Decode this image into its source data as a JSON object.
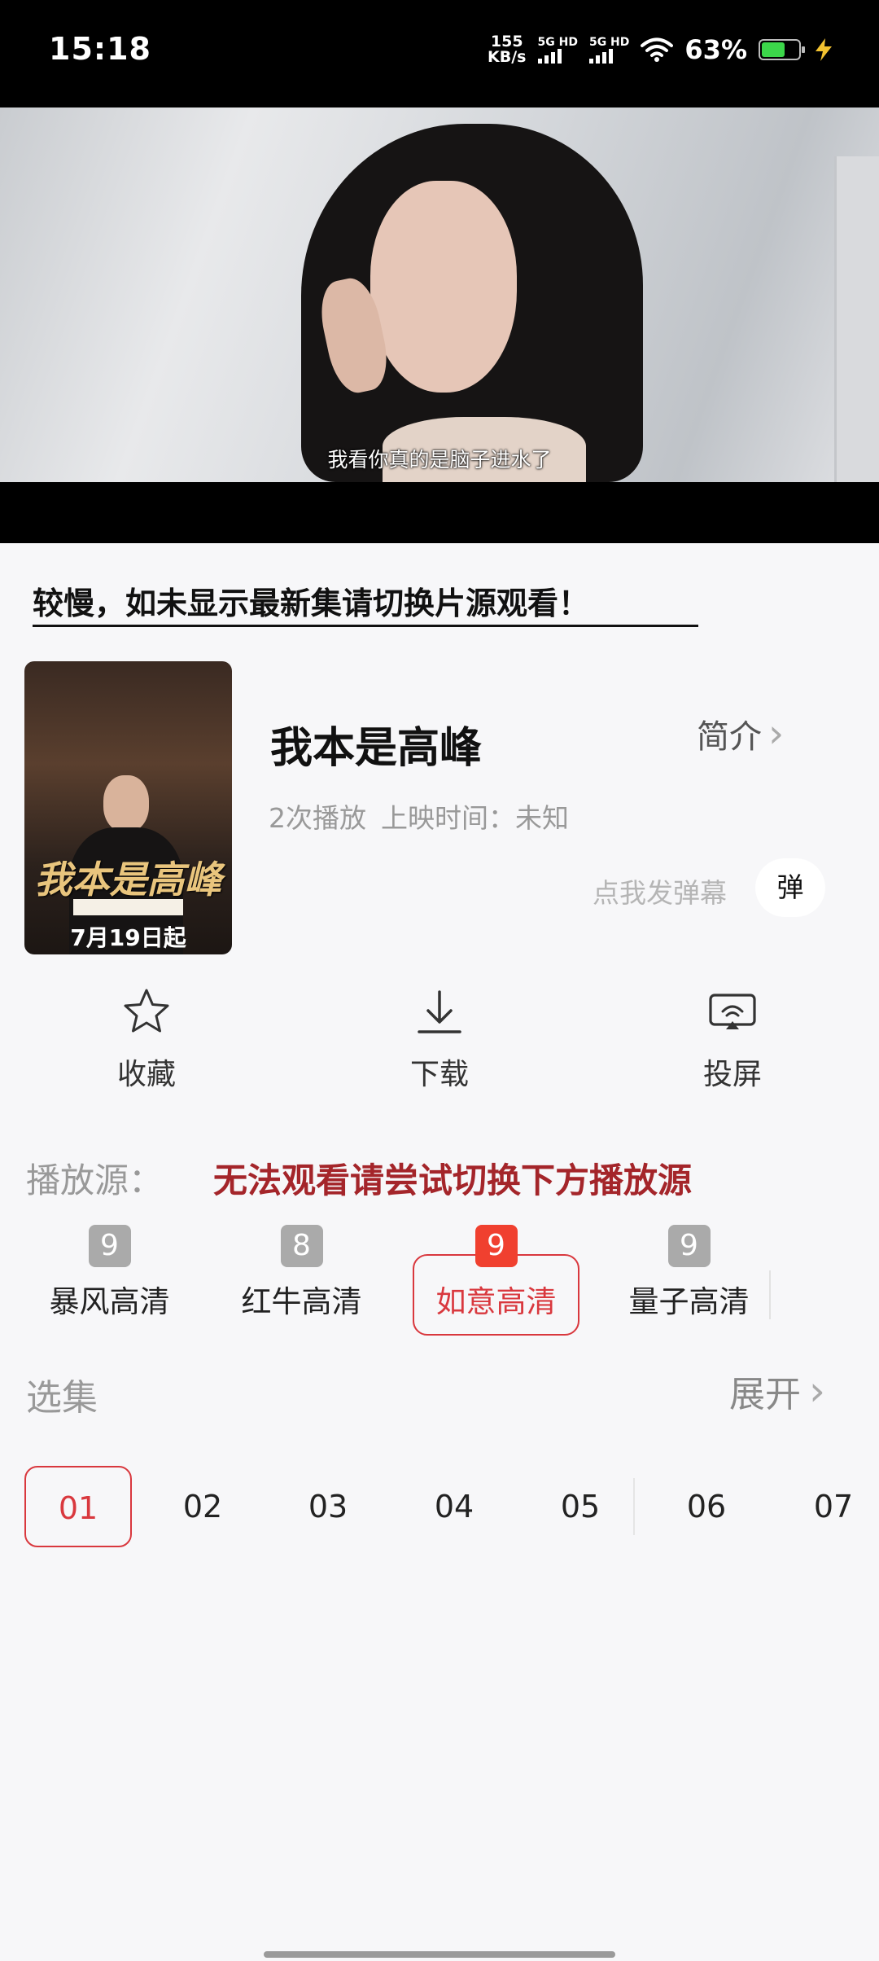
{
  "status_bar": {
    "time": "15:18",
    "net_speed_value": "155",
    "net_speed_unit": "KB/s",
    "signal1": "5G HD",
    "signal2": "5G HD",
    "battery": "63%",
    "battery_level": 0.63,
    "icons": [
      "wifi-icon",
      "battery-icon",
      "charging-icon"
    ]
  },
  "video": {
    "subtitle": "我看你真的是脑子进水了"
  },
  "notice": "较慢，如未显示最新集请切换片源观看！",
  "show": {
    "poster_title": "我本是高峰",
    "poster_date": "7月19日起",
    "title": "我本是高峰",
    "intro_label": "简介",
    "plays": "2次播放",
    "release": "上映时间：未知",
    "danmu_hint": "点我发弹幕",
    "danmu_button": "弹"
  },
  "actions": [
    {
      "label": "收藏",
      "icon": "star-icon"
    },
    {
      "label": "下载",
      "icon": "download-icon"
    },
    {
      "label": "投屏",
      "icon": "cast-icon"
    }
  ],
  "sources": {
    "label": "播放源：",
    "warning": "无法观看请尝试切换下方播放源",
    "items": [
      {
        "label": "暴风高清",
        "count": "9"
      },
      {
        "label": "红牛高清",
        "count": "8"
      },
      {
        "label": "如意高清",
        "count": "9",
        "active": true
      },
      {
        "label": "量子高清",
        "count": "9"
      }
    ]
  },
  "episodes": {
    "label": "选集",
    "expand_label": "展开",
    "items": [
      "01",
      "02",
      "03",
      "04",
      "05",
      "06",
      "07"
    ],
    "active_index": 0
  },
  "colors": {
    "accent": "#d9383e",
    "badge_active": "#f0402f",
    "warning": "#a4252a"
  }
}
